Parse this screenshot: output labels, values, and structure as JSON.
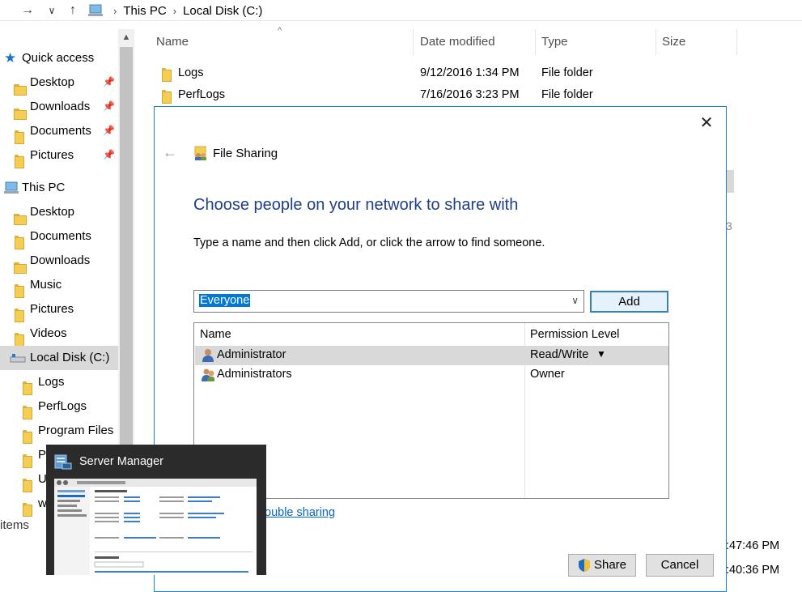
{
  "breadcrumb": {
    "this_pc": "This PC",
    "local_disk": "Local Disk (C:)",
    "sep": "›"
  },
  "nav": {
    "quick_access": "Quick access",
    "quick_items": [
      {
        "label": "Desktop"
      },
      {
        "label": "Downloads"
      },
      {
        "label": "Documents"
      },
      {
        "label": "Pictures"
      }
    ],
    "this_pc": "This PC",
    "pc_items": [
      {
        "label": "Desktop"
      },
      {
        "label": "Documents"
      },
      {
        "label": "Downloads"
      },
      {
        "label": "Music"
      },
      {
        "label": "Pictures"
      },
      {
        "label": "Videos"
      }
    ],
    "local_disk": "Local Disk (C:)",
    "disk_items": [
      {
        "label": "Logs"
      },
      {
        "label": "PerfLogs"
      },
      {
        "label": "Program Files"
      },
      {
        "label": "Pr"
      },
      {
        "label": "U"
      },
      {
        "label": "w"
      }
    ]
  },
  "file_list": {
    "columns": {
      "name": "Name",
      "date": "Date modified",
      "type": "Type",
      "size": "Size"
    },
    "rows": [
      {
        "name": "Logs",
        "date": "9/12/2016 1:34 PM",
        "type": "File folder"
      },
      {
        "name": "PerfLogs",
        "date": "7/16/2016 3:23 PM",
        "type": "File folder"
      }
    ],
    "hidden_fragment": "3"
  },
  "status": {
    "items": "items",
    "time1": ":47:46 PM",
    "time2": ":40:36 PM"
  },
  "dialog": {
    "title": "File Sharing",
    "heading": "Choose people on your network to share with",
    "instruction": "Type a name and then click Add, or click the arrow to find someone.",
    "name_value": "Everyone",
    "add_label": "Add",
    "table": {
      "col_name": "Name",
      "col_perm": "Permission Level",
      "rows": [
        {
          "name": "Administrator",
          "perm": "Read/Write"
        },
        {
          "name": "Administrators",
          "perm": "Owner"
        }
      ]
    },
    "trouble_link": "ouble sharing",
    "share_label": "Share",
    "cancel_label": "Cancel"
  },
  "taskbar_thumb": {
    "title": "Server Manager"
  },
  "colors": {
    "accent": "#1883d7",
    "heading": "#1e3e8c",
    "selection": "#0078d7",
    "link": "#0066cc"
  }
}
